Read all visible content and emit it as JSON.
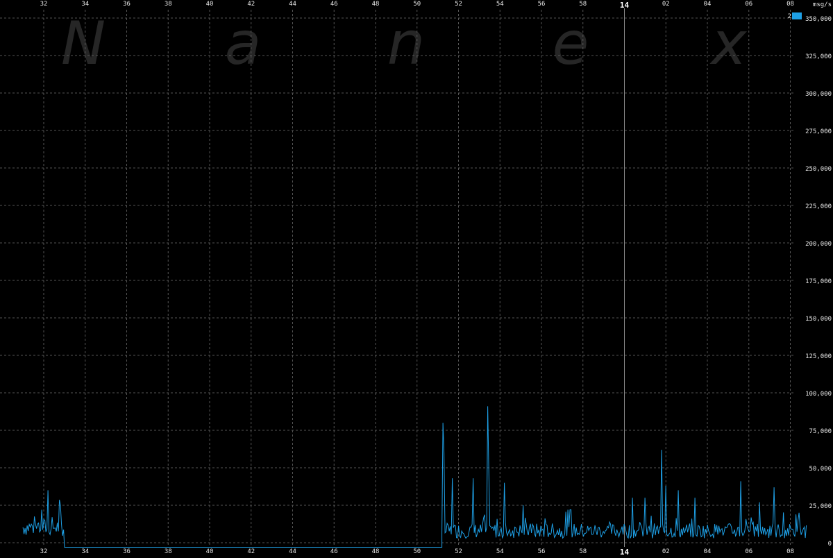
{
  "chart_data": {
    "type": "line",
    "watermark": "Nanex",
    "unit_label": "msg/s",
    "legend": {
      "label": "2",
      "color": "#1ea0e6",
      "placement": "top-right"
    },
    "colors": {
      "background": "#000000",
      "grid": "#555555",
      "series": "#1ea0e6",
      "marker_line": "#8a8a8a",
      "text": "#e8e8e8",
      "watermark": "#262626"
    },
    "grid": true,
    "x_tick_labels": [
      "32",
      "34",
      "36",
      "38",
      "40",
      "42",
      "44",
      "46",
      "48",
      "50",
      "52",
      "54",
      "56",
      "58",
      "14",
      "02",
      "04",
      "06",
      "08"
    ],
    "x_major_tick": "14",
    "ylim": [
      0,
      350000
    ],
    "y_tick_labels": [
      "0",
      "25,000",
      "50,000",
      "75,000",
      "100,000",
      "125,000",
      "150,000",
      "175,000",
      "200,000",
      "225,000",
      "250,000",
      "275,000",
      "300,000",
      "325,000",
      "350,000"
    ],
    "series": [
      {
        "name": "2",
        "segments": [
          {
            "x_start": "31",
            "x_end": "33",
            "baseline": 8000,
            "amplitude": 6000,
            "spikes": [
              {
                "x": "32.2",
                "y": 35000
              },
              {
                "x": "31.9",
                "y": 22000
              },
              {
                "x": "32.8",
                "y": 25000
              },
              {
                "x": "33.0",
                "y": 25000
              }
            ]
          },
          {
            "x_start": "33",
            "x_end": "51.2",
            "baseline": -3000,
            "amplitude": 0,
            "spikes": []
          },
          {
            "x_start": "51.2",
            "x_end": "68.8",
            "baseline": 6000,
            "amplitude": 5000,
            "spikes": [
              {
                "x": "51.25",
                "y": 80000
              },
              {
                "x": "51.3",
                "y": 60000
              },
              {
                "x": "51.7",
                "y": 43000
              },
              {
                "x": "52.7",
                "y": 43000
              },
              {
                "x": "53.4",
                "y": 91000
              },
              {
                "x": "53.45",
                "y": 50000
              },
              {
                "x": "54.2",
                "y": 40000
              },
              {
                "x": "55.1",
                "y": 25000
              },
              {
                "x": "57.4",
                "y": 22000
              },
              {
                "x": "60.4",
                "y": 30000
              },
              {
                "x": "61.0",
                "y": 30000
              },
              {
                "x": "61.8",
                "y": 62000
              },
              {
                "x": "62.0",
                "y": 38000
              },
              {
                "x": "62.6",
                "y": 35000
              },
              {
                "x": "63.4",
                "y": 30000
              },
              {
                "x": "65.6",
                "y": 41000
              },
              {
                "x": "66.5",
                "y": 27000
              },
              {
                "x": "67.2",
                "y": 37000
              },
              {
                "x": "68.4",
                "y": 20000
              }
            ]
          }
        ]
      }
    ]
  }
}
